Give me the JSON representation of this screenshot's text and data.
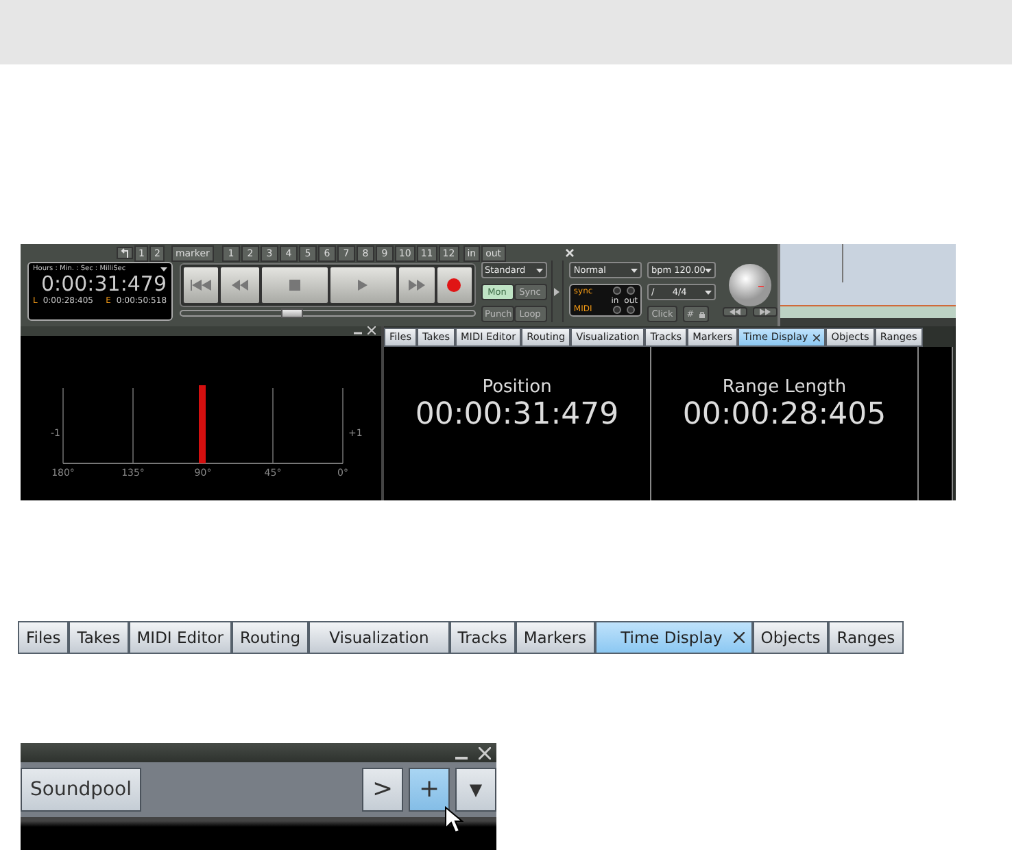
{
  "transport": {
    "locator_buttons": [
      "1",
      "2"
    ],
    "marker_label": "marker",
    "marker_buttons": [
      "1",
      "2",
      "3",
      "4",
      "5",
      "6",
      "7",
      "8",
      "9",
      "10",
      "11",
      "12"
    ],
    "in_out": [
      "in",
      "out"
    ],
    "position_slider": {
      "level": 0.38
    },
    "time_format": "Hours : Min. : Sec : MilliSec",
    "time": "0:00:31:479",
    "range": [
      {
        "key": "L",
        "value": "0:00:28:405"
      },
      {
        "key": "E",
        "value": "0:00:50:518"
      }
    ],
    "mode": "Standard",
    "mode_buttons": [
      {
        "label": "Mon",
        "on": true
      },
      {
        "label": "Sync",
        "on": false
      },
      {
        "label": "Punch",
        "on": false
      },
      {
        "label": "Loop",
        "on": false
      }
    ],
    "speed": "Normal",
    "sync_label": "sync",
    "midi_label": "MIDI",
    "in_label": "in",
    "out_label": "out",
    "bpm": "bpm 120.00",
    "signature_slash": "/",
    "signature": "4/4",
    "click": "Click",
    "grid_button": "#"
  },
  "phase_meter": {
    "left_label": "-1",
    "right_label": "+1",
    "ticks": [
      "180°",
      "135°",
      "90°",
      "45°",
      "0°"
    ],
    "level": 0.5
  },
  "tabs": [
    {
      "label": "Files",
      "selected": false
    },
    {
      "label": "Takes",
      "selected": false
    },
    {
      "label": "MIDI Editor",
      "selected": false
    },
    {
      "label": "Routing",
      "selected": false
    },
    {
      "label": "Visualization",
      "selected": false
    },
    {
      "label": "Tracks",
      "selected": false
    },
    {
      "label": "Markers",
      "selected": false
    },
    {
      "label": "Time Display",
      "selected": true
    },
    {
      "label": "Objects",
      "selected": false
    },
    {
      "label": "Ranges",
      "selected": false
    }
  ],
  "displays": [
    {
      "label": "Position",
      "value": "00:00:31:479"
    },
    {
      "label": "Range Length",
      "value": "00:00:28:405"
    }
  ],
  "tabs_large": [
    {
      "label": "Files",
      "selected": false
    },
    {
      "label": "Takes",
      "selected": false
    },
    {
      "label": "MIDI Editor",
      "selected": false
    },
    {
      "label": "Routing",
      "selected": false
    },
    {
      "label": "Visualization",
      "selected": false
    },
    {
      "label": "Tracks",
      "selected": false
    },
    {
      "label": "Markers",
      "selected": false
    },
    {
      "label": "Time Display",
      "selected": true
    },
    {
      "label": "Objects",
      "selected": false
    },
    {
      "label": "Ranges",
      "selected": false
    }
  ],
  "soundpool": {
    "tab": "Soundpool",
    "next": ">",
    "add": "+",
    "menu": "▼"
  }
}
